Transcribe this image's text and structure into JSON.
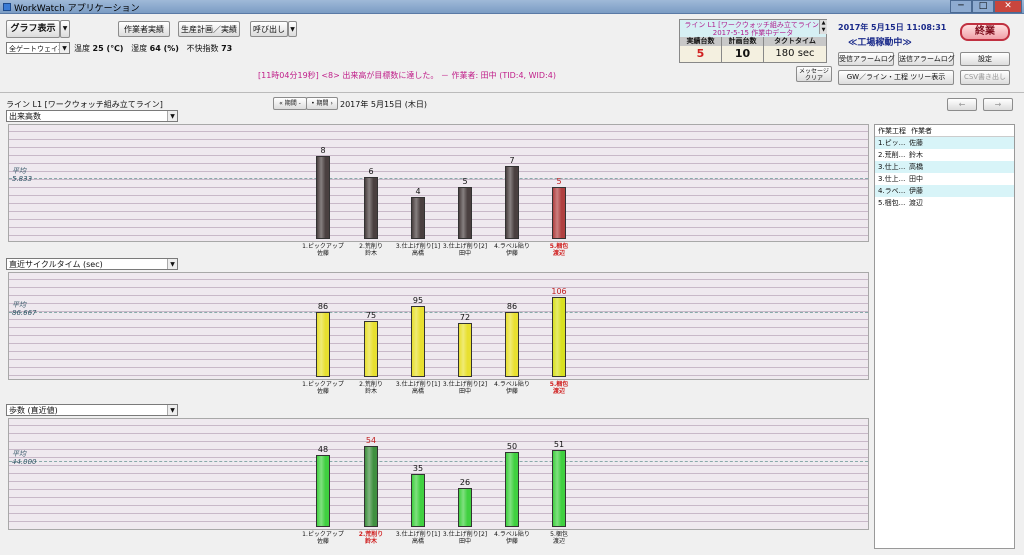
{
  "window": {
    "title": "WorkWatch アプリケーション",
    "min": "─",
    "max": "□",
    "close": "✕"
  },
  "toolbar": {
    "graph_display": "グラフ表示",
    "worker_actual": "作業者実績",
    "production_plan": "生産計画／実績",
    "call": "呼び出し"
  },
  "env": {
    "gateway": "全ゲートウェイ平均",
    "temp_label": "温度",
    "temp_value": "25 (℃)",
    "humidity_label": "湿度",
    "humidity_value": "64 (%)",
    "discomfort_label": "不快指数",
    "discomfort_value": "73"
  },
  "message": {
    "text": "[11時04分19秒] <8> 出来高が目標数に達した。 － 作業者: 田中 (TID:4, WID:4)",
    "clear": "メッセージクリア"
  },
  "line_info": {
    "title": "ライン L1 [ワークウォッチ組み立てライン]",
    "subtitle": "2017-5-15 作業中データ",
    "headers": [
      "実績台数",
      "計画台数",
      "タクトタイム"
    ],
    "values": [
      "5",
      "10",
      "180 sec"
    ]
  },
  "status": {
    "datetime": "2017年 5月15日 11:08:31",
    "state": "≪工場稼動中≫",
    "end_button": "終業"
  },
  "right_buttons": {
    "recv_alarm": "受信アラームログ",
    "send_alarm": "送信アラームログ",
    "settings": "設定",
    "tree": "GW／ライン・工程 ツリー表示",
    "csv": "CSV書き出し"
  },
  "period": {
    "line_title": "ライン L1 [ワークウォッチ組み立てライン]",
    "prev": "« 期間 -",
    "next": "• 期間 ›",
    "date": "2017年 5月15日 (木日)",
    "back": "←",
    "fwd": "→"
  },
  "charts": [
    {
      "title": "出来高数",
      "avg_label": "平均",
      "avg_value": "5.833",
      "avg": 5.833,
      "max": 10
    },
    {
      "title": "直近サイクルタイム (sec)",
      "avg_label": "平均",
      "avg_value": "86.667",
      "avg": 86.667,
      "max": 125
    },
    {
      "title": "歩数 (直近値)",
      "avg_label": "平均",
      "avg_value": "44.000",
      "avg": 44,
      "max": 65
    }
  ],
  "chart_data": [
    {
      "type": "bar",
      "title": "出来高数",
      "categories": [
        "1.ピックアップ 佐藤",
        "2.荒削り 鈴木",
        "3.仕上げ削り[1] 高橋",
        "3.仕上げ削り[2] 田中",
        "4.ラベル貼り 伊藤",
        "5.梱包 渡辺"
      ],
      "values": [
        8,
        6,
        4,
        5,
        7,
        5
      ],
      "color": "#4a4040",
      "highlight_index": 5,
      "highlight_color": "#b04040"
    },
    {
      "type": "bar",
      "title": "直近サイクルタイム (sec)",
      "categories": [
        "1.ピックアップ 佐藤",
        "2.荒削り 鈴木",
        "3.仕上げ削り[1] 高橋",
        "3.仕上げ削り[2] 田中",
        "4.ラベル貼り 伊藤",
        "5.梱包 渡辺"
      ],
      "values": [
        86,
        75,
        95,
        72,
        86,
        106
      ],
      "color": "#e8e030",
      "highlight_index": 5,
      "highlight_color": "#d8e020"
    },
    {
      "type": "bar",
      "title": "歩数 (直近値)",
      "categories": [
        "1.ピックアップ 佐藤",
        "2.荒削り 鈴木",
        "3.仕上げ削り[1] 高橋",
        "3.仕上げ削り[2] 田中",
        "4.ラベル貼り 伊藤",
        "5.梱包 渡辺"
      ],
      "values": [
        48,
        54,
        35,
        26,
        50,
        51
      ],
      "color": "#40d040",
      "highlight_index": 1,
      "highlight_color": "#409040"
    }
  ],
  "x_labels": [
    {
      "a": "1.ピックアップ",
      "b": "佐藤"
    },
    {
      "a": "2.荒削り",
      "b": "鈴木"
    },
    {
      "a": "3.仕上げ削り[1]",
      "b": "高橋"
    },
    {
      "a": "3.仕上げ削り[2]",
      "b": "田中"
    },
    {
      "a": "4.ラベル貼り",
      "b": "伊藤"
    },
    {
      "a": "5.梱包",
      "b": "渡辺"
    }
  ],
  "worker_list": {
    "headers": [
      "作業工程",
      "作業者"
    ],
    "rows": [
      {
        "process": "1.ピッ...",
        "worker": "佐藤"
      },
      {
        "process": "2.荒削...",
        "worker": "鈴木"
      },
      {
        "process": "3.仕上...",
        "worker": "高橋"
      },
      {
        "process": "3.仕上...",
        "worker": "田中"
      },
      {
        "process": "4.ラベ...",
        "worker": "伊藤"
      },
      {
        "process": "5.梱包...",
        "worker": "渡辺"
      }
    ]
  }
}
